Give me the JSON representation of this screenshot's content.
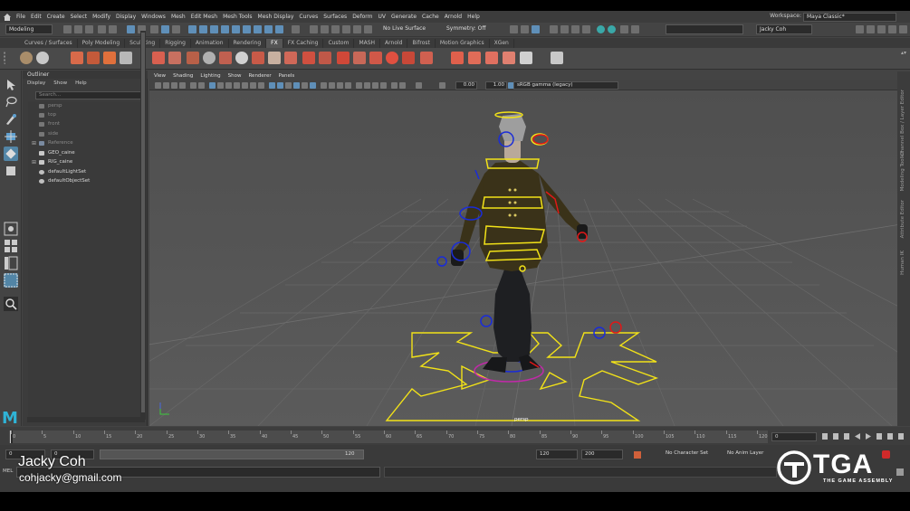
{
  "app": {
    "menubar": [
      "File",
      "Edit",
      "Create",
      "Select",
      "Modify",
      "Display",
      "Windows",
      "Mesh",
      "Edit Mesh",
      "Mesh Tools",
      "Mesh Display",
      "Curves",
      "Surfaces",
      "Deform",
      "UV",
      "Generate",
      "Cache",
      "Arnold",
      "Help"
    ],
    "workspace_label": "Workspace:",
    "workspace_value": "Maya Classic*"
  },
  "statusline": {
    "menuset": "Modeling",
    "live_surface": "No Live Surface",
    "symmetry": "Symmetry: Off",
    "user": "Jacky Coh"
  },
  "shelf_tabs": [
    "Curves / Surfaces",
    "Poly Modeling",
    "Sculpting",
    "Rigging",
    "Animation",
    "Rendering",
    "FX",
    "FX Caching",
    "Custom",
    "MASH",
    "Arnold",
    "Bifrost",
    "Motion Graphics",
    "XGen"
  ],
  "active_shelf_tab": "FX",
  "outliner": {
    "title": "Outliner",
    "menu": [
      "Display",
      "Show",
      "Help"
    ],
    "search_placeholder": "Search...",
    "items": [
      {
        "label": "persp",
        "dim": true
      },
      {
        "label": "top",
        "dim": true
      },
      {
        "label": "front",
        "dim": true
      },
      {
        "label": "side",
        "dim": true
      },
      {
        "label": "Reference",
        "dim": true
      },
      {
        "label": "GEO_caine",
        "dim": false
      },
      {
        "label": "RIG_caine",
        "dim": false
      },
      {
        "label": "defaultLightSet",
        "dim": false
      },
      {
        "label": "defaultObjectSet",
        "dim": false
      }
    ]
  },
  "viewport": {
    "menu": [
      "View",
      "Shading",
      "Lighting",
      "Show",
      "Renderer",
      "Panels"
    ],
    "field_a": "0.00",
    "field_b": "1.00",
    "color_space": "sRGB gamma (legacy)",
    "camera_label": "persp"
  },
  "right_dock": [
    "Channel Box / Layer Editor",
    "Modeling Toolkit",
    "Attribute Editor",
    "Human IK"
  ],
  "timeline": {
    "ticks": [
      "0",
      "5",
      "10",
      "15",
      "20",
      "25",
      "30",
      "35",
      "40",
      "45",
      "50",
      "55",
      "60",
      "65",
      "70",
      "75",
      "80",
      "85",
      "90",
      "95",
      "100",
      "105",
      "110",
      "115",
      "120"
    ],
    "current_frame": "0"
  },
  "range": {
    "start": "0",
    "playback_start": "0",
    "slider_label": "120",
    "playback_end": "120",
    "end": "200",
    "character_set": "No Character Set",
    "anim_layer": "No Anim Layer"
  },
  "cmdline": {
    "label": "MEL"
  },
  "overlay": {
    "name": "Jacky Coh",
    "email": "cohjacky@gmail.com",
    "logo_text": "TGA",
    "logo_sub": "THE GAME ASSEMBLY"
  },
  "colors": {
    "rig_yellow": "#f2e218",
    "rig_blue": "#1a2cd8",
    "rig_red": "#e01818",
    "rig_magenta": "#c02aa8",
    "maya_blue": "#2fb3d6"
  }
}
